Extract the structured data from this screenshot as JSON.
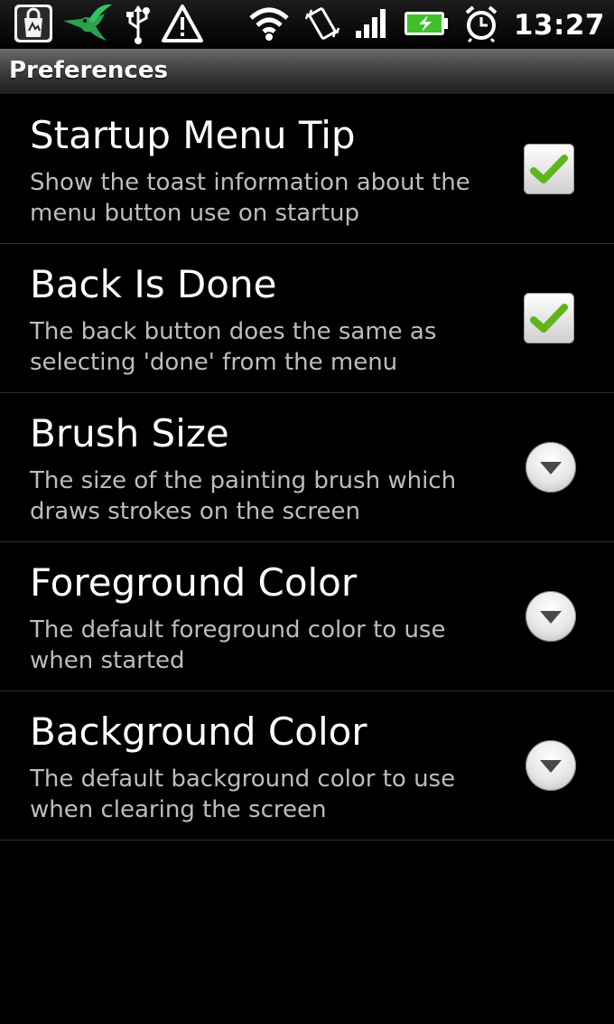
{
  "status_bar": {
    "time": "13:27",
    "icons": [
      "market-bag-icon",
      "hummingbird-icon",
      "usb-icon",
      "warning-icon",
      "wifi-icon",
      "vibrate-icon",
      "signal-icon",
      "battery-charging-icon",
      "alarm-icon"
    ]
  },
  "title_bar": {
    "title": "Preferences"
  },
  "preferences": [
    {
      "title": "Startup Menu Tip",
      "summary": "Show the toast information about the menu button use on startup",
      "widget": "checkbox",
      "checked": true
    },
    {
      "title": "Back Is Done",
      "summary": "The back button does the same as selecting 'done' from the menu",
      "widget": "checkbox",
      "checked": true
    },
    {
      "title": "Brush Size",
      "summary": "The size of the painting brush which draws strokes on the screen",
      "widget": "dropdown"
    },
    {
      "title": "Foreground Color",
      "summary": "The default foreground color to use when started",
      "widget": "dropdown"
    },
    {
      "title": "Background Color",
      "summary": "The default background color to use when clearing the screen",
      "widget": "dropdown"
    }
  ],
  "colors": {
    "check": "#5fb51c",
    "background": "#000000",
    "summary_text": "#bdbdbd",
    "divider": "#2e2e2e"
  }
}
